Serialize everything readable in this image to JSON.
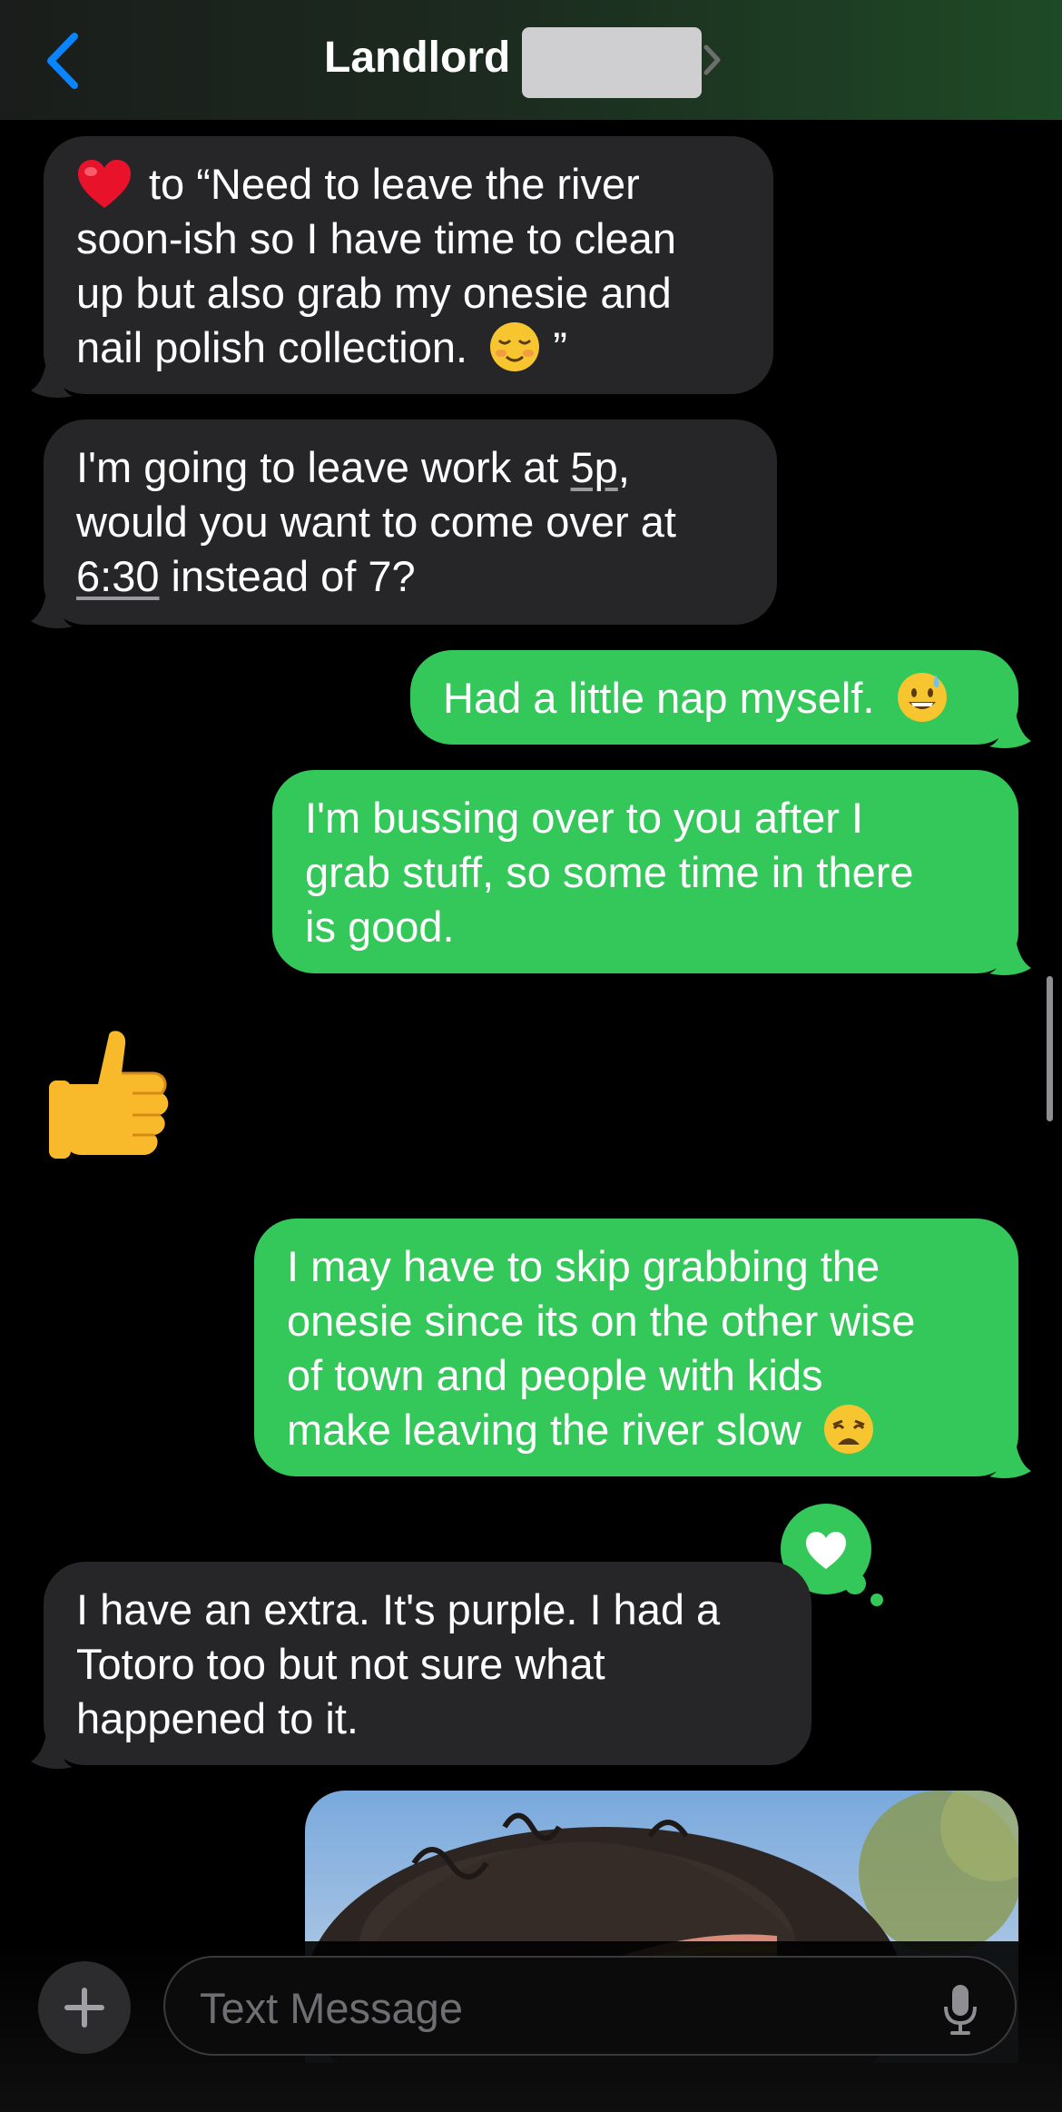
{
  "header": {
    "back_icon": "chevron-left-icon",
    "title": "Landlord",
    "name_chevron_icon": "chevron-right-icon",
    "accent_color": "#0a84ff"
  },
  "messages": [
    {
      "direction": "incoming",
      "lines": [
        "to “Need to leave the river",
        "soon-ish so I have time to clean",
        "up but also grab my onesie and",
        "nail polish collection.",
        "”"
      ],
      "reaction_icon": "heart-emoji",
      "trailing_emoji": "relieved-face-emoji"
    },
    {
      "direction": "incoming",
      "lines": [
        "I'm going to leave work at",
        "5p",
        ",",
        "would you want to come over at",
        "6:30",
        "instead of 7?"
      ]
    },
    {
      "direction": "outgoing",
      "lines": [
        "Had a little nap myself."
      ],
      "trailing_emoji": "grinning-face-with-sweat-emoji"
    },
    {
      "direction": "outgoing",
      "lines": [
        "I'm bussing over to you after I",
        "grab stuff, so some time in there",
        "is good."
      ]
    },
    {
      "direction": "incoming",
      "type": "emoji",
      "emoji": "thumbs-up-emoji"
    },
    {
      "direction": "outgoing",
      "lines": [
        "I may have to skip grabbing the",
        "onesie since its on the other wise",
        "of town and people with kids",
        "make leaving the river slow"
      ],
      "trailing_emoji": "weary-face-emoji",
      "tapback_icon": "heart-tapback-icon"
    },
    {
      "direction": "incoming",
      "lines": [
        "I have an extra. It's purple. I had a",
        "Totoro too but not sure what",
        "happened to it."
      ]
    },
    {
      "direction": "outgoing",
      "type": "photo"
    }
  ],
  "composer": {
    "add_icon": "plus-icon",
    "placeholder": "Text Message",
    "value": "",
    "mic_icon": "microphone-icon"
  },
  "colors": {
    "incoming_bubble": "#262628",
    "outgoing_bubble": "#34c759",
    "background": "#000000"
  }
}
